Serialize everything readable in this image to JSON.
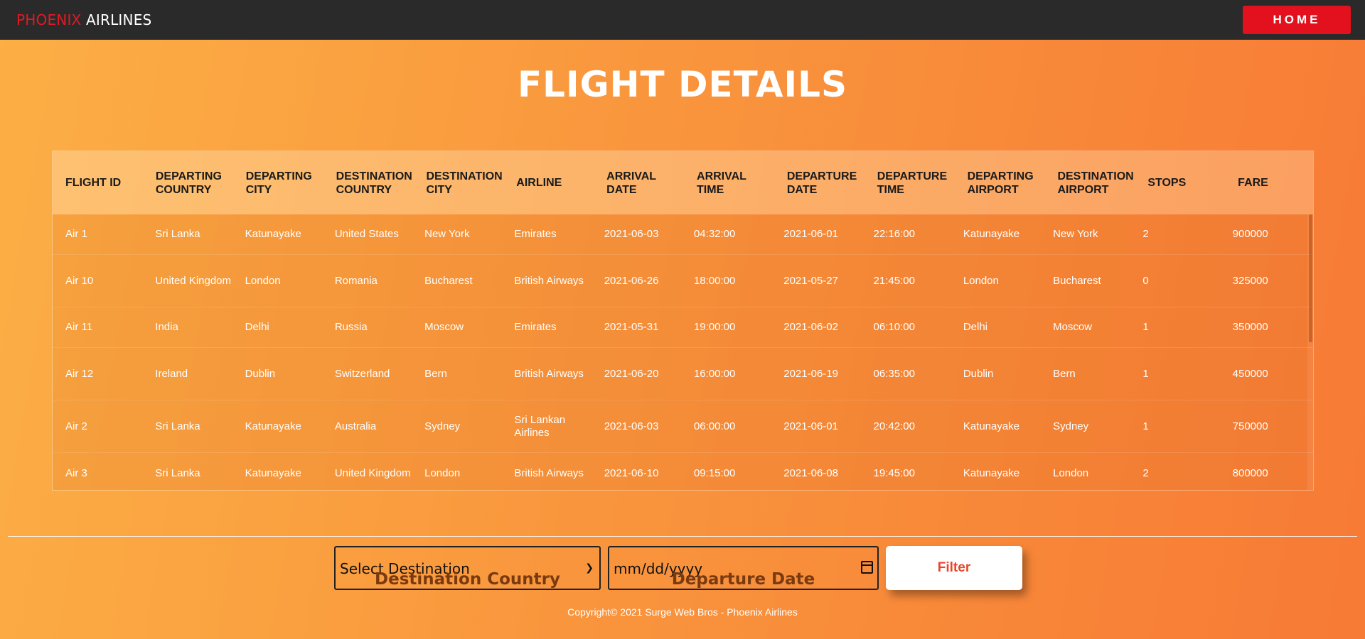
{
  "nav": {
    "brand_part1": "PHOENIX",
    "brand_part2": " AIRLINES",
    "home_label": "HOME"
  },
  "page_title": "FLIGHT DETAILS",
  "table": {
    "headers": [
      "FLIGHT ID",
      "DEPARTING COUNTRY",
      "DEPARTING CITY",
      "DESTINATION COUNTRY",
      "DESTINATION CITY",
      "AIRLINE",
      "ARRIVAL DATE",
      "ARRIVAL TIME",
      "DEPARTURE DATE",
      "DEPARTURE TIME",
      "DEPARTING AIRPORT",
      "DESTINATION AIRPORT",
      "STOPS",
      "FARE"
    ],
    "rows": [
      [
        "Air 1",
        "Sri Lanka",
        "Katunayake",
        "United States",
        "New York",
        "Emirates",
        "2021-06-03",
        "04:32:00",
        "2021-06-01",
        "22:16:00",
        "Katunayake",
        "New York",
        "2",
        "900000"
      ],
      [
        "Air 10",
        "United Kingdom",
        "London",
        "Romania",
        "Bucharest",
        "British Airways",
        "2021-06-26",
        "18:00:00",
        "2021-05-27",
        "21:45:00",
        "London",
        "Bucharest",
        "0",
        "325000"
      ],
      [
        "Air 11",
        "India",
        "Delhi",
        "Russia",
        "Moscow",
        "Emirates",
        "2021-05-31",
        "19:00:00",
        "2021-06-02",
        "06:10:00",
        "Delhi",
        "Moscow",
        "1",
        "350000"
      ],
      [
        "Air 12",
        "Ireland",
        "Dublin",
        "Switzerland",
        "Bern",
        "British Airways",
        "2021-06-20",
        "16:00:00",
        "2021-06-19",
        "06:35:00",
        "Dublin",
        "Bern",
        "1",
        "450000"
      ],
      [
        "Air 2",
        "Sri Lanka",
        "Katunayake",
        "Australia",
        "Sydney",
        "Sri Lankan Airlines",
        "2021-06-03",
        "06:00:00",
        "2021-06-01",
        "20:42:00",
        "Katunayake",
        "Sydney",
        "1",
        "750000"
      ],
      [
        "Air 3",
        "Sri Lanka",
        "Katunayake",
        "United Kingdom",
        "London",
        "British Airways",
        "2021-06-10",
        "09:15:00",
        "2021-06-08",
        "19:45:00",
        "Katunayake",
        "London",
        "2",
        "800000"
      ]
    ]
  },
  "filters": {
    "destination_select_value": "Select Destination",
    "destination_label": "Destination Country",
    "date_value": "mm/dd/yyyy",
    "date_label": "Departure Date",
    "filter_label": "Filter"
  },
  "footer": {
    "copyright": "Copyright© 2021 Surge Web Bros - Phoenix Airlines"
  },
  "colors": {
    "navbar": "#2a2a2a",
    "brand_red": "#e01a25",
    "home_button": "#e3111d",
    "filter_text": "#e8452a"
  }
}
